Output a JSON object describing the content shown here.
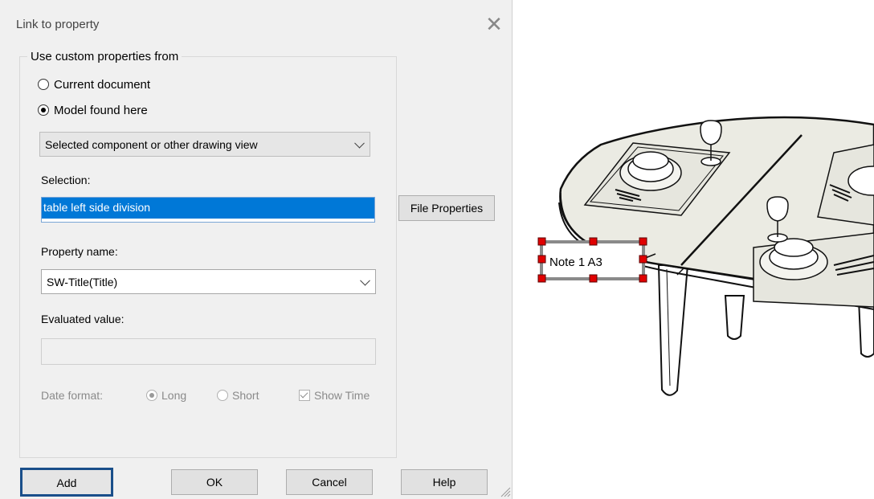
{
  "dialog": {
    "title": "Link to property",
    "group_label": "Use custom properties from",
    "radio_current": "Current document",
    "radio_model": "Model found here",
    "source_combo": "Selected component or other drawing view",
    "selection_label": "Selection:",
    "selection_value": "table left side division",
    "file_properties_button": "File Properties",
    "property_name_label": "Property name:",
    "property_name_value": "SW-Title(Title)",
    "evaluated_value_label": "Evaluated value:",
    "evaluated_value": "",
    "date_format_label": "Date format:",
    "date_long": "Long",
    "date_short": "Short",
    "show_time": "Show Time",
    "buttons": {
      "add": "Add",
      "ok": "OK",
      "cancel": "Cancel",
      "help": "Help"
    }
  },
  "drawing": {
    "note_label": "Note 1 A3"
  },
  "colors": {
    "selection_highlight": "#0078d7",
    "handle_red": "#e00000",
    "table_top_fill": "#ebebe3"
  }
}
